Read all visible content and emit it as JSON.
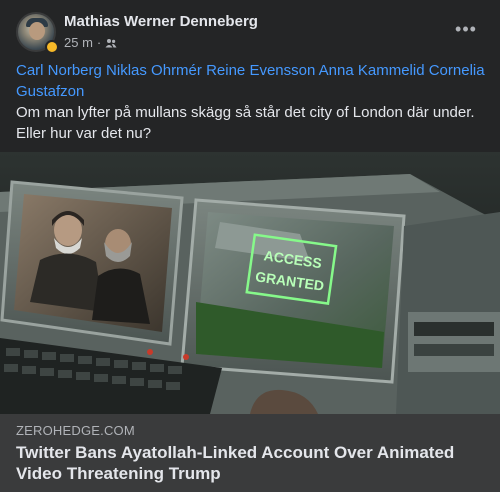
{
  "post": {
    "author": "Mathias Werner Denneberg",
    "time": "25 m",
    "separator": "·",
    "audience_icon": "friends-icon",
    "more_icon": "more-dots-icon",
    "more_label": "•••",
    "tags": [
      "Carl Norberg",
      "Niklas Ohrmér",
      "Reine Evensson",
      "Anna Kammelid",
      "Cornelia Gustafzon"
    ],
    "message": "Om man lyfter på mullans skägg så står det city of London där under. Eller hur var det nu?"
  },
  "link": {
    "domain": "ZEROHEDGE.COM",
    "headline": "Twitter Bans Ayatollah-Linked Account Over Animated Video Threatening Trump",
    "image_caption": [
      "ACCESS",
      "GRANTED"
    ]
  },
  "colors": {
    "background": "#242526",
    "link_info_bg": "#3a3b3c",
    "tag_blue": "#4599ff",
    "text_primary": "#e4e6eb",
    "text_secondary": "#b0b3b8",
    "access_green": "#7cff7c"
  }
}
